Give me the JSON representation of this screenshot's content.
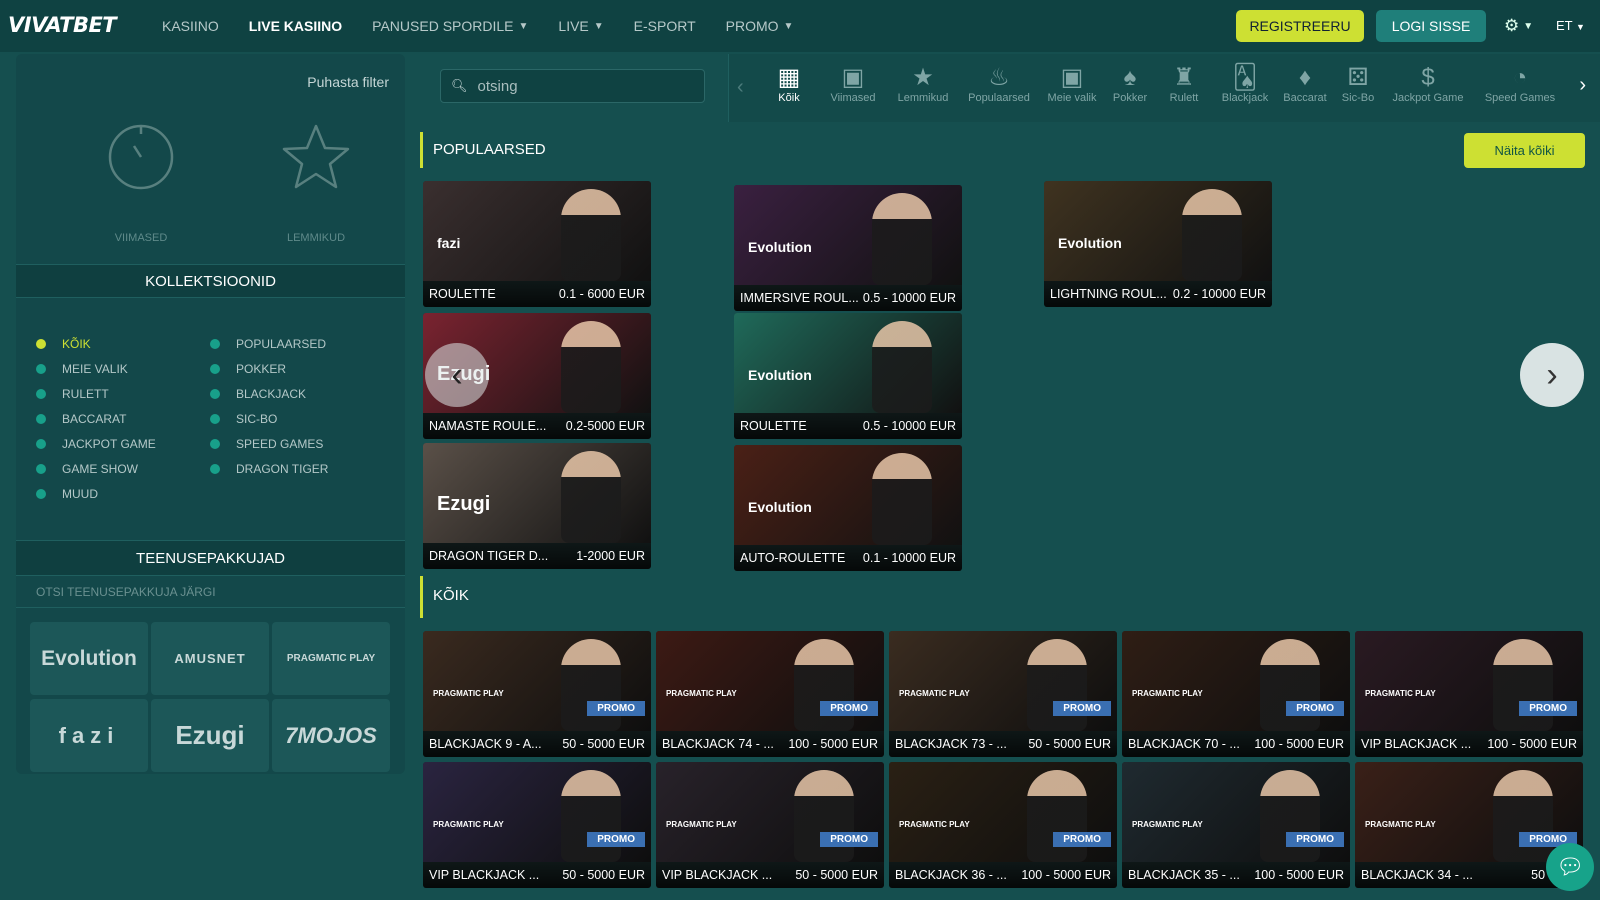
{
  "header": {
    "logo": "VIVATBET",
    "nav": [
      {
        "label": "KASIINO",
        "dropdown": false,
        "active": false
      },
      {
        "label": "LIVE KASIINO",
        "dropdown": false,
        "active": true
      },
      {
        "label": "PANUSED SPORDILE",
        "dropdown": true,
        "active": false
      },
      {
        "label": "LIVE",
        "dropdown": true,
        "active": false
      },
      {
        "label": "E-SPORT",
        "dropdown": false,
        "active": false
      },
      {
        "label": "PROMO",
        "dropdown": true,
        "active": false
      }
    ],
    "register": "REGISTREERU",
    "login": "LOGI SISSE",
    "lang": "ET"
  },
  "sidebar": {
    "clear_filter": "Puhasta filter",
    "recent": "VIIMASED",
    "favorites": "LEMMIKUD",
    "collections_title": "KOLLEKTSIOONID",
    "collections_left": [
      "KÕIK",
      "MEIE VALIK",
      "RULETT",
      "BACCARAT",
      "JACKPOT GAME",
      "GAME SHOW",
      "MUUD"
    ],
    "collections_right": [
      "POPULAARSED",
      "POKKER",
      "BLACKJACK",
      "SIC-BO",
      "SPEED GAMES",
      "DRAGON TIGER"
    ],
    "providers_title": "TEENUSEPAKKUJAD",
    "provider_search": "OTSI TEENUSEPAKKUJA JÄRGI",
    "providers": [
      "Evolution",
      "AMUSNET",
      "PRAGMATIC PLAY",
      "fazi",
      "Ezugi",
      "7MOJOS"
    ]
  },
  "search": {
    "placeholder": "otsing"
  },
  "categories": [
    {
      "label": "Kõik",
      "icon": "grid-icon",
      "glyph": "▦",
      "active": true
    },
    {
      "label": "Viimased",
      "icon": "recent-icon",
      "glyph": "▣",
      "active": false
    },
    {
      "label": "Lemmikud",
      "icon": "star-icon",
      "glyph": "★",
      "active": false
    },
    {
      "label": "Populaarsed",
      "icon": "flame-icon",
      "glyph": "♨",
      "active": false
    },
    {
      "label": "Meie valik",
      "icon": "pick-icon",
      "glyph": "▣",
      "active": false
    },
    {
      "label": "Pokker",
      "icon": "poker-icon",
      "glyph": "♠",
      "active": false
    },
    {
      "label": "Rulett",
      "icon": "roulette-icon",
      "glyph": "♜",
      "active": false
    },
    {
      "label": "Blackjack",
      "icon": "blackjack-icon",
      "glyph": "🂡",
      "active": false
    },
    {
      "label": "Baccarat",
      "icon": "baccarat-icon",
      "glyph": "♦",
      "active": false
    },
    {
      "label": "Sic-Bo",
      "icon": "dice-icon",
      "glyph": "⚄",
      "active": false
    },
    {
      "label": "Jackpot Game",
      "icon": "jackpot-icon",
      "glyph": "$",
      "active": false
    },
    {
      "label": "Speed Games",
      "icon": "speedometer-icon",
      "glyph": "◔",
      "active": false
    }
  ],
  "popular": {
    "title": "POPULAARSED",
    "show_all": "Näita kõiki",
    "games": [
      {
        "name": "ROULETTE",
        "limits": "0.1 - 6000 EUR",
        "provider": "fazi",
        "bg": "#3a2f2f"
      },
      {
        "name": "NAMASTE ROULE...",
        "limits": "0.2-5000 EUR",
        "provider": "Ezugi",
        "bg": "#7a2330"
      },
      {
        "name": "DRAGON TIGER D...",
        "limits": "1-2000 EUR",
        "provider": "Ezugi",
        "bg": "#5a5048"
      },
      {
        "name": "IMMERSIVE ROUL...",
        "limits": "0.5 - 10000 EUR",
        "provider": "Evolution",
        "bg": "#3a2040"
      },
      {
        "name": "ROULETTE",
        "limits": "0.5 - 10000 EUR",
        "provider": "Evolution",
        "bg": "#1f6a5a"
      },
      {
        "name": "AUTO-ROULETTE",
        "limits": "0.1 - 10000 EUR",
        "provider": "Evolution",
        "bg": "#4a2016"
      },
      {
        "name": "LIGHTNING ROUL...",
        "limits": "0.2 - 10000 EUR",
        "provider": "Evolution",
        "bg": "#3f3320"
      }
    ]
  },
  "all": {
    "title": "KÕIK",
    "promo": "PROMO",
    "provider": "PRAGMATIC PLAY",
    "games": [
      {
        "name": "BLACKJACK 9 - A...",
        "limits": "50 - 5000 EUR"
      },
      {
        "name": "BLACKJACK 74 - ...",
        "limits": "100 - 5000 EUR"
      },
      {
        "name": "BLACKJACK 73 - ...",
        "limits": "50 - 5000 EUR"
      },
      {
        "name": "BLACKJACK 70 - ...",
        "limits": "100 - 5000 EUR"
      },
      {
        "name": "VIP BLACKJACK ...",
        "limits": "100 - 5000 EUR"
      },
      {
        "name": "VIP BLACKJACK ...",
        "limits": "50 - 5000 EUR"
      },
      {
        "name": "VIP BLACKJACK ...",
        "limits": "50 - 5000 EUR"
      },
      {
        "name": "BLACKJACK 36 - ...",
        "limits": "100 - 5000 EUR"
      },
      {
        "name": "BLACKJACK 35 - ...",
        "limits": "100 - 5000 EUR"
      },
      {
        "name": "BLACKJACK 34 - ...",
        "limits": "50 - 500"
      }
    ]
  },
  "colors": {
    "accent": "#cde033",
    "bg": "#154f4f",
    "header": "#0f4242",
    "teal_button": "#1f7f7a"
  }
}
